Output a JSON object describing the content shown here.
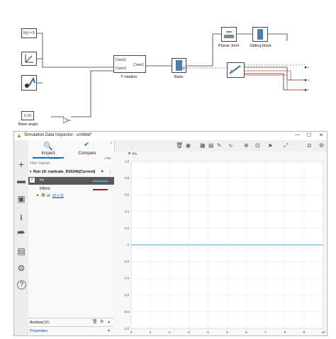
{
  "diagram": {
    "solver_block_label": "f(x) = 0",
    "yrot": {
      "port_conn2": "Conn2",
      "port_conn3": "Conn3",
      "port_conn1": "Conn1",
      "name": "Y rotation"
    },
    "base_label": "Base",
    "planar_joint_label": "Planar Joint",
    "sliding_block_label": "Sliding block",
    "const_value": "0.19",
    "const_name": "Base angle",
    "port_b": "B",
    "port_f": "F",
    "port_r": "R",
    "port_p": "P"
  },
  "sdi": {
    "title": "Simulation Data Inspector - untitled*",
    "tabs": {
      "inspect": "Inspect",
      "compare": "Compare"
    },
    "columns": {
      "name": "NAME",
      "line": "LINE"
    },
    "filter_placeholder": "Filter Signals",
    "run_label": "Run 16: replicate_R2024b[Current]",
    "signals": [
      {
        "name": "Fn",
        "color": "#3aa7d8",
        "checked": true,
        "selected": true
      },
      {
        "name": "FBmn",
        "color": "#9b1b2a",
        "checked": false,
        "selected": false
      }
    ],
    "group": {
      "name": "vt",
      "dims": "(2 x 1)"
    },
    "archive_label": "Archive",
    "archive_count": "(15)",
    "properties_label": "Properties",
    "legend_label": "Fn",
    "accent_color": "#0072bd"
  },
  "chart_data": {
    "type": "line",
    "series": [
      {
        "name": "Fn",
        "x": [
          0,
          10
        ],
        "y": [
          0,
          0
        ],
        "color": "#3aa7d8"
      }
    ],
    "xlim": [
      0,
      10
    ],
    "ylim": [
      -1,
      1
    ],
    "xticks": [
      "0",
      "1",
      "2",
      "3",
      "4",
      "5",
      "6",
      "7",
      "8",
      "9",
      "10"
    ],
    "yticks": [
      "-1.0",
      "-0.8",
      "-0.6",
      "-0.4",
      "-0.2",
      "0",
      "0.2",
      "0.4",
      "0.6",
      "0.8",
      "1.0"
    ],
    "grid": true,
    "legend": "top-left"
  }
}
